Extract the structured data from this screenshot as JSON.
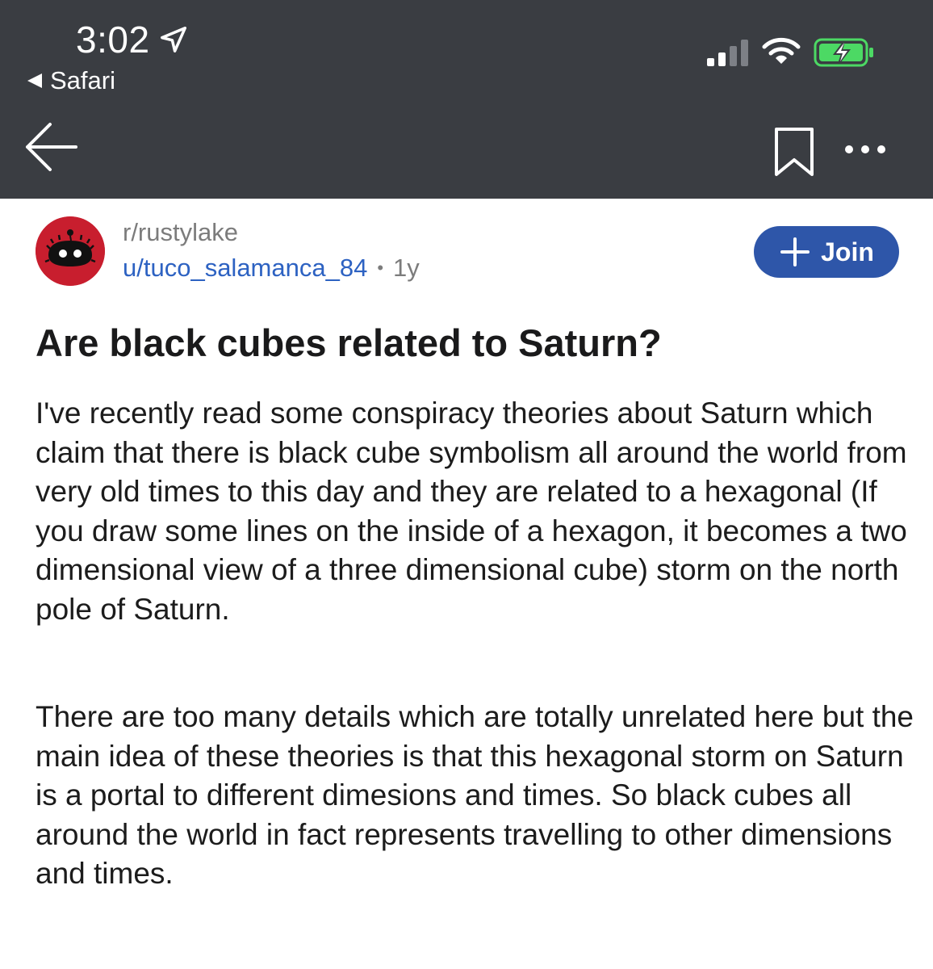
{
  "status_bar": {
    "time": "3:02",
    "back_app": "Safari"
  },
  "icons": {
    "location": "location-arrow-icon",
    "signal": "cellular-signal-icon",
    "wifi": "wifi-icon",
    "battery": "battery-charging-icon",
    "back": "back-arrow-icon",
    "bookmark": "bookmark-icon",
    "more": "more-options-icon"
  },
  "colors": {
    "header_bg": "#3a3d42",
    "join_bg": "#2e56a9",
    "username": "#2d62c2",
    "avatar_bg": "#c81e2e",
    "battery_green": "#4cd964"
  },
  "post": {
    "subreddit": "r/rustylake",
    "username": "u/tuco_salamanca_84",
    "separator": "•",
    "age": "1y",
    "join_label": "Join",
    "title": "Are black cubes related to Saturn?",
    "paragraphs": [
      "I've recently read some conspiracy theories about Saturn which claim that there is black cube symbolism all around the world from very old times to this day and they are related to a hexagonal (If you draw some lines on the inside of a hexagon, it becomes a two dimensional view of a three dimensional cube) storm on the north pole of Saturn.",
      "There are too many details which are totally unrelated here but the main idea of these theories is that this hexagonal storm on Saturn is a portal to different dimesions and times. So black cubes all around the world in fact represents travelling to other dimensions and times."
    ]
  }
}
